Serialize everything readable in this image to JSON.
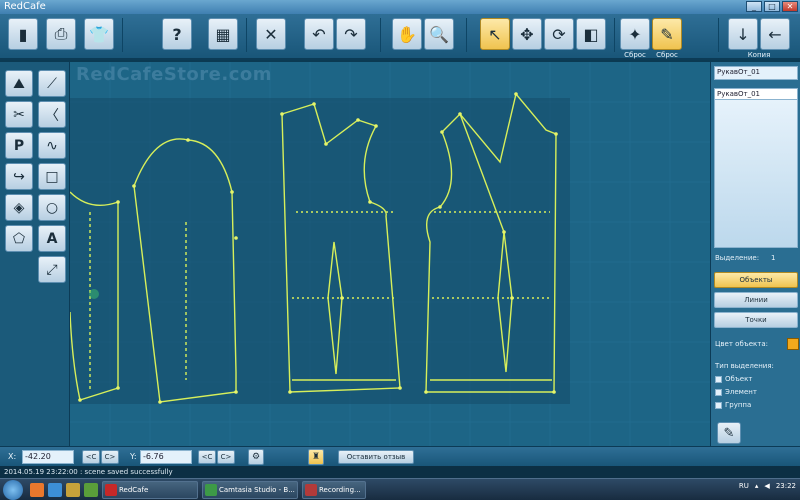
{
  "window": {
    "title": "RedCafe",
    "buttons": [
      "_",
      "□",
      "✕"
    ]
  },
  "toolbar": {
    "buttons": [
      {
        "name": "new-file-icon",
        "glyph": "▮"
      },
      {
        "name": "print-icon",
        "glyph": "⎙"
      },
      {
        "name": "tshirt-icon",
        "glyph": "👕"
      },
      {
        "name": "help-icon",
        "glyph": "?"
      },
      {
        "name": "calculator-icon",
        "glyph": "▦"
      },
      {
        "name": "cut-icon",
        "glyph": "✕"
      },
      {
        "name": "undo-icon",
        "glyph": "↶"
      },
      {
        "name": "redo-icon",
        "glyph": "↷"
      },
      {
        "name": "hand-icon",
        "glyph": "✋"
      },
      {
        "name": "zoom-icon",
        "glyph": "🔍"
      },
      {
        "name": "pointer-icon",
        "glyph": "↖"
      },
      {
        "name": "move-icon",
        "glyph": "✥"
      },
      {
        "name": "rotate-icon",
        "glyph": "⟳"
      },
      {
        "name": "mirror-icon",
        "glyph": "◧"
      },
      {
        "name": "reset-pin-icon",
        "glyph": "✦"
      },
      {
        "name": "reset-pencil-icon",
        "glyph": "✎"
      },
      {
        "name": "copy-down-icon",
        "glyph": "↓"
      },
      {
        "name": "copy-left-icon",
        "glyph": "←"
      }
    ],
    "reset_label_1": "Сброс",
    "reset_label_2": "Сброс",
    "copy_label": "Копия"
  },
  "palette": {
    "tools": [
      {
        "name": "triangle-tool-icon",
        "glyph": "⛰"
      },
      {
        "name": "line-tool-icon",
        "glyph": "⟋"
      },
      {
        "name": "scissors-tool-icon",
        "glyph": "✂"
      },
      {
        "name": "angle-tool-icon",
        "glyph": "〈"
      },
      {
        "name": "point-tool-icon",
        "glyph": "P"
      },
      {
        "name": "curve-tool-icon",
        "glyph": "∿"
      },
      {
        "name": "arc-tool-icon",
        "glyph": "↪"
      },
      {
        "name": "rectangle-tool-icon",
        "glyph": "□"
      },
      {
        "name": "eraser-tool-icon",
        "glyph": "◈"
      },
      {
        "name": "circle-tool-icon",
        "glyph": "○"
      },
      {
        "name": "polygon-tool-icon",
        "glyph": "⬠"
      },
      {
        "name": "text-tool-icon",
        "glyph": "A"
      },
      {
        "name": "measure-tool-icon",
        "glyph": "⤢"
      }
    ]
  },
  "canvas": {
    "watermark": "RedCafeStore.com"
  },
  "right_panel": {
    "object_name": "РукавОт_01",
    "list_items": [
      "РукавОт_01"
    ],
    "selection_label": "Выделение:",
    "selection_count": "1",
    "btn_objects": "Объекты",
    "btn_lines": "Линии",
    "btn_points": "Точки",
    "color_label": "Цвет объекта:",
    "selection_type_label": "Тип выделения:",
    "checkboxes": [
      "Объект",
      "Элемент",
      "Группа"
    ],
    "accent_color": "#f2a91c"
  },
  "bottom": {
    "x_label": "X:",
    "x_value": "-42.20",
    "y_label": "Y:",
    "y_value": "-6.76",
    "prev_label": "<C",
    "next_label": "C>",
    "feedback_label": "Оставить отзыв"
  },
  "status": {
    "message": "2014.05.19 23:22:00 : scene saved successfully"
  },
  "taskbar": {
    "tasks": [
      "RedCafe",
      "Camtasia Studio - B...",
      "Recording..."
    ],
    "lang": "RU",
    "time": "23:22",
    "date": "23:22"
  }
}
